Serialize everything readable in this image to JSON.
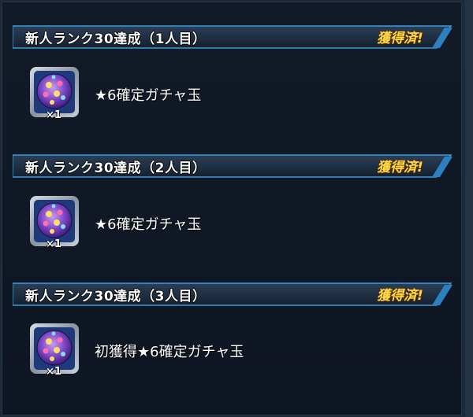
{
  "rewards": [
    {
      "title": "新人ランク30達成（1人目）",
      "badge": "獲得済!",
      "item_name": "★6確定ガチャ玉",
      "quantity": "×1",
      "icon": "gacha-orb-icon"
    },
    {
      "title": "新人ランク30達成（2人目）",
      "badge": "獲得済!",
      "item_name": "★6確定ガチャ玉",
      "quantity": "×1",
      "icon": "gacha-orb-icon"
    },
    {
      "title": "新人ランク30達成（3人目）",
      "badge": "獲得済!",
      "item_name": "初獲得★6確定ガチャ玉",
      "quantity": "×1",
      "icon": "gacha-orb-icon"
    }
  ],
  "colors": {
    "background": "#0f1623",
    "banner_accent": "#3b9bd9",
    "badge": "#ffd84a",
    "orb_outer": "#6a3bb0",
    "orb_inner": "#e85a9a"
  }
}
